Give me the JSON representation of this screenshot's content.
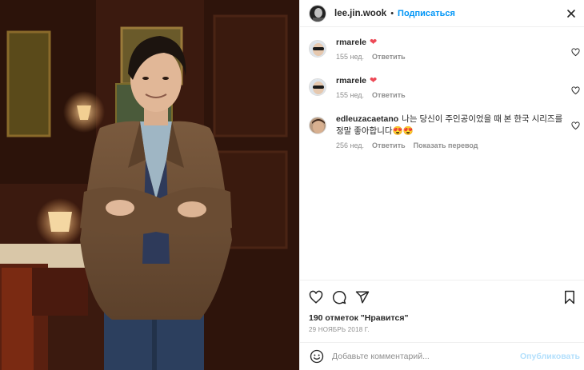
{
  "post": {
    "username": "lee.jin.wook",
    "separator": "•",
    "follow_label": "Подписаться",
    "likes_text": "190 отметок \"Нравится\"",
    "date_text": "29 НОЯБРЬ 2018 Г."
  },
  "comments": [
    {
      "username": "rmarele",
      "text": "❤",
      "age": "155 нед.",
      "reply_label": "Ответить",
      "translate_label": ""
    },
    {
      "username": "rmarele",
      "text": "❤",
      "age": "155 нед.",
      "reply_label": "Ответить",
      "translate_label": ""
    },
    {
      "username": "edleuzacaetano",
      "text": "나는 당신이 주인공이었을 때 본 한국 시리즈를 정말 좋아합니다😍😍",
      "age": "256 нед.",
      "reply_label": "Ответить",
      "translate_label": "Показать перевод"
    }
  ],
  "add_comment": {
    "placeholder": "Добавьте комментарий...",
    "publish_label": "Опубликовать"
  },
  "icons": {
    "close": "close-icon",
    "like": "heart-icon",
    "comment": "comment-icon",
    "share": "share-icon",
    "save": "bookmark-icon",
    "emoji": "emoji-icon"
  },
  "colors": {
    "accent": "#0095f6",
    "heart": "#ed4956",
    "muted": "#8e8e8e",
    "publish_disabled": "#b2dffc"
  }
}
